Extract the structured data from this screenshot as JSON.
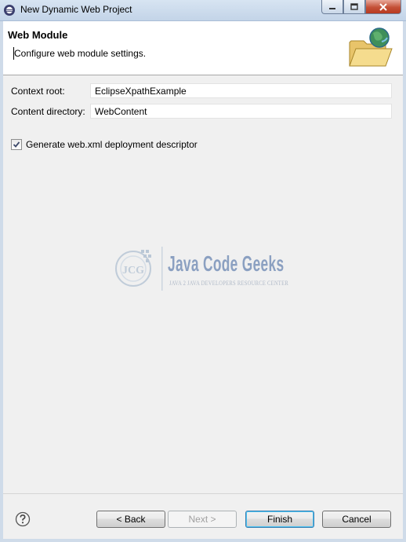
{
  "window": {
    "title": "New Dynamic Web Project"
  },
  "header": {
    "title": "Web Module",
    "description": "Configure web module settings."
  },
  "form": {
    "context_root": {
      "label": "Context root:",
      "value": "EclipseXpathExample"
    },
    "content_directory": {
      "label": "Content directory:",
      "value": "WebContent"
    },
    "generate_descriptor": {
      "label": "Generate web.xml deployment descriptor",
      "checked": true
    }
  },
  "watermark": {
    "brand": "Java Code Geeks",
    "tagline": "JAVA 2 JAVA DEVELOPERS RESOURCE CENTER"
  },
  "footer": {
    "back": "< Back",
    "next": "Next >",
    "finish": "Finish",
    "cancel": "Cancel"
  },
  "colors": {
    "accent": "#3c7fb1",
    "brand_blue": "#2f5ea8",
    "brand_orange": "#e07a1f"
  }
}
